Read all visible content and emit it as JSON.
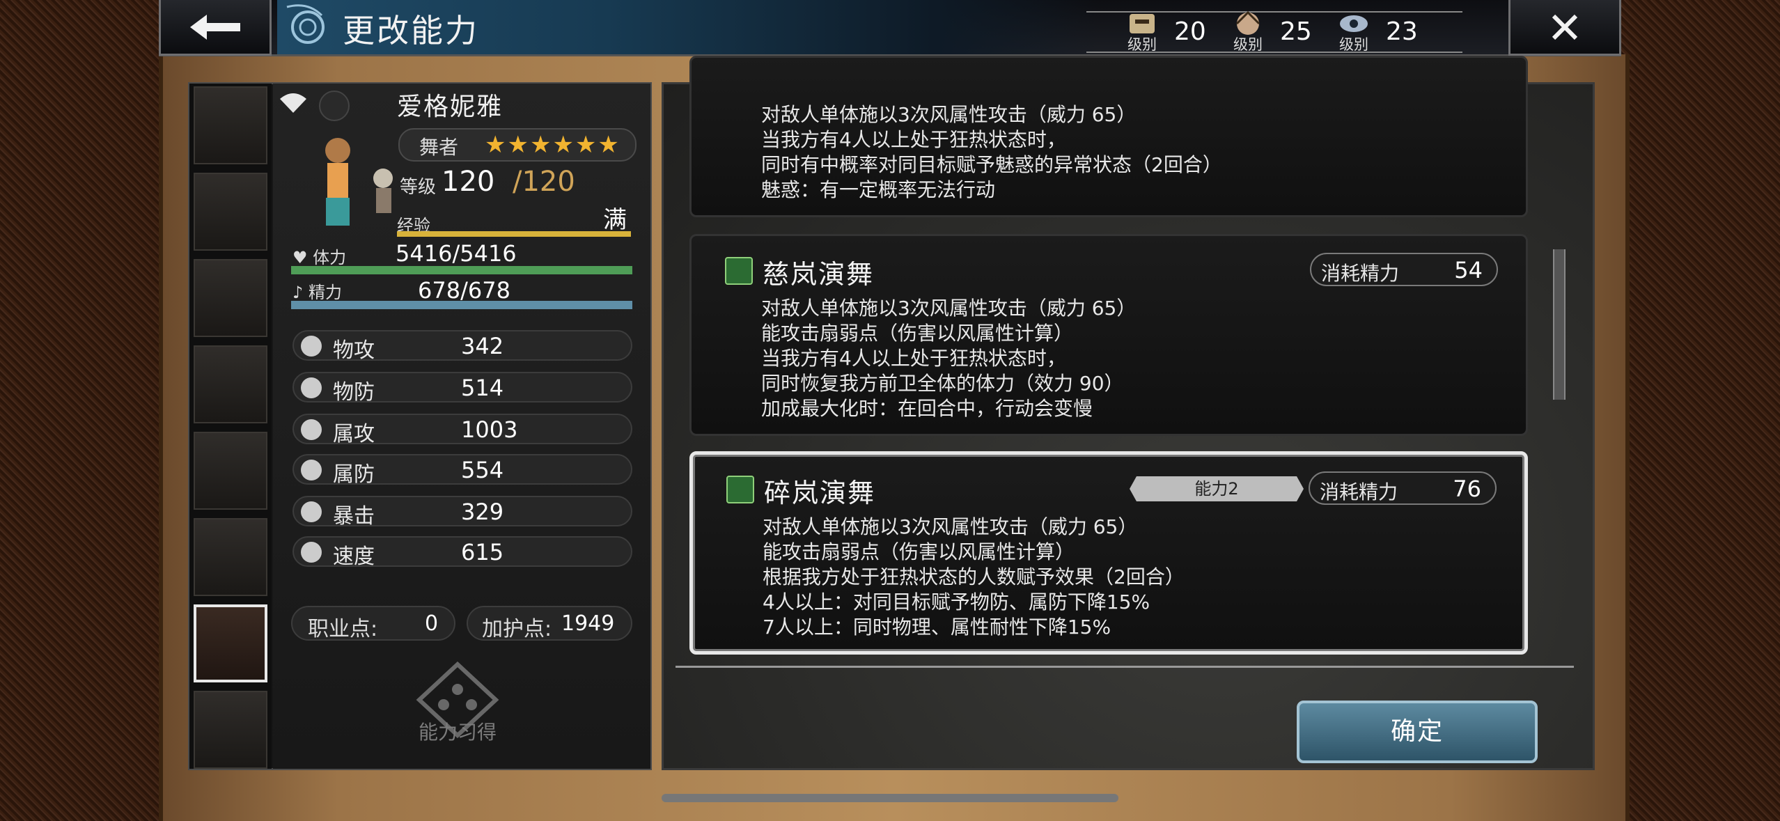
{
  "header": {
    "title": "更改能力",
    "levels": [
      {
        "icon": "level-icon-1",
        "caption": "级别",
        "value": "20"
      },
      {
        "icon": "level-icon-2",
        "caption": "级别",
        "value": "25"
      },
      {
        "icon": "level-icon-3",
        "caption": "级别",
        "value": "23"
      }
    ]
  },
  "character": {
    "name": "爱格妮雅",
    "job": "舞者",
    "stars": "★★★★★★",
    "level_label": "等级",
    "level_current": "120",
    "level_max": "/120",
    "exp_label": "经验",
    "exp_status": "满",
    "hp_label": "体力",
    "hp": "5416/5416",
    "sp_label": "精力",
    "sp": "678/678"
  },
  "stats": [
    {
      "label": "物攻",
      "value": "342"
    },
    {
      "label": "物防",
      "value": "514"
    },
    {
      "label": "属攻",
      "value": "1003"
    },
    {
      "label": "属防",
      "value": "554"
    },
    {
      "label": "暴击",
      "value": "329"
    },
    {
      "label": "速度",
      "value": "615"
    }
  ],
  "points": {
    "job_label": "职业点:",
    "job_value": "0",
    "guard_label": "加护点:",
    "guard_value": "1949"
  },
  "learn_label": "能力习得",
  "abilities": [
    {
      "name": "",
      "cost_label": "",
      "cost": "",
      "desc": "对敌人单体施以3次风属性攻击（威力 65）\n当我方有4人以上处于狂热状态时，\n同时有中概率对同目标赋予魅惑的异常状态（2回合）\n魅惑：有一定概率无法行动"
    },
    {
      "name": "慈岚演舞",
      "cost_label": "消耗精力",
      "cost": "54",
      "desc": "对敌人单体施以3次风属性攻击（威力 65）\n能攻击扇弱点（伤害以风属性计算）\n当我方有4人以上处于狂热状态时，\n同时恢复我方前卫全体的体力（效力 90）\n加成最大化时：在回合中，行动会变慢"
    },
    {
      "name": "碎岚演舞",
      "tag": "能力2",
      "cost_label": "消耗精力",
      "cost": "76",
      "desc": "对敌人单体施以3次风属性攻击（威力 65）\n能攻击扇弱点（伤害以风属性计算）\n根据我方处于狂热状态的人数赋予效果（2回合）\n4人以上：对同目标赋予物防、属防下降15%\n7人以上：同时物理、属性耐性下降15%"
    }
  ],
  "confirm_label": "确定"
}
